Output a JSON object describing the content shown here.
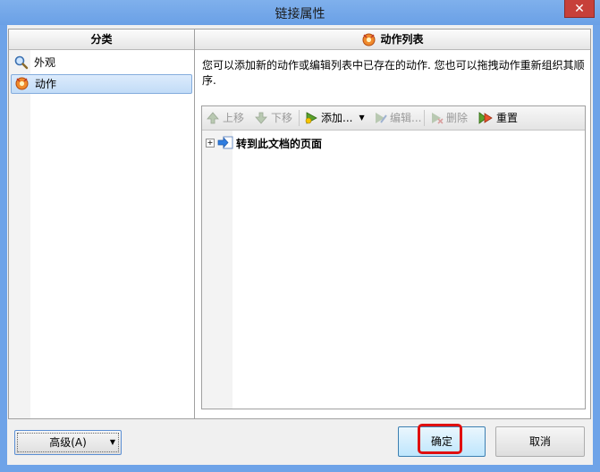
{
  "window": {
    "title": "链接属性",
    "close_label": "✕"
  },
  "left_pane": {
    "header": "分类",
    "items": [
      {
        "label": "外观",
        "icon": "magnifier-icon",
        "selected": false
      },
      {
        "label": "动作",
        "icon": "action-gear-icon",
        "selected": true
      }
    ]
  },
  "right_pane": {
    "header": "动作列表",
    "description": "您可以添加新的动作或编辑列表中已存在的动作. 您也可以拖拽动作重新组织其顺序.",
    "toolbar": {
      "move_up": "上移",
      "move_down": "下移",
      "add": "添加...",
      "edit": "编辑...",
      "delete": "删除",
      "reset": "重置"
    },
    "actions": [
      {
        "label": "转到此文档的页面"
      }
    ]
  },
  "buttons": {
    "advanced": "高级(A)",
    "ok": "确定",
    "cancel": "取消"
  },
  "colors": {
    "highlight": "#e01010",
    "titlebar": "#6ea3e8"
  }
}
